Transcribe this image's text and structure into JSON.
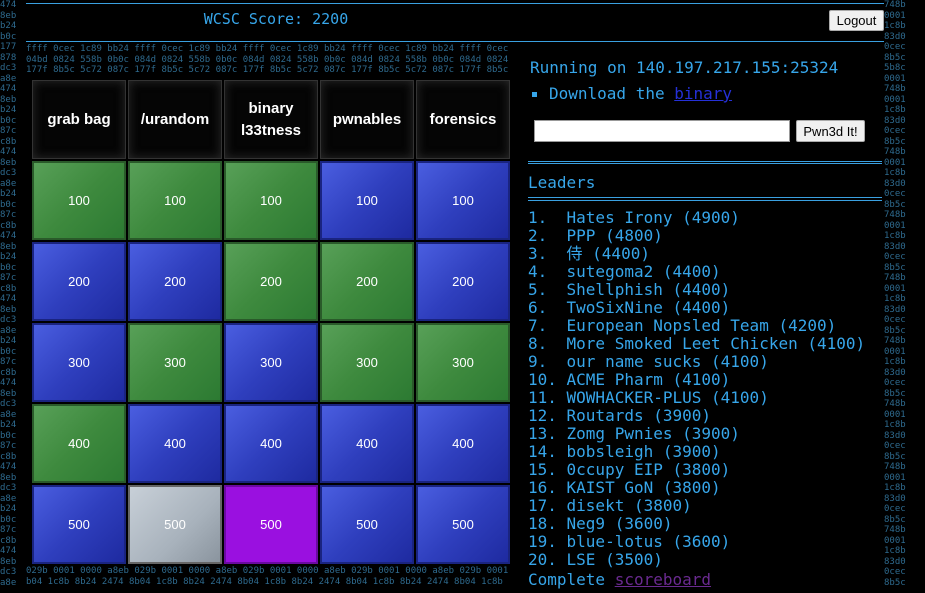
{
  "header": {
    "score_label": "WCSC Score: 2200",
    "logout_label": "Logout"
  },
  "board": {
    "categories": [
      "grab bag",
      "/urandom",
      "binary l33tness",
      "pwnables",
      "forensics"
    ],
    "points": [
      "100",
      "200",
      "300",
      "400",
      "500"
    ],
    "cell_states": [
      [
        "green",
        "blue",
        "blue",
        "green",
        "blue"
      ],
      [
        "green",
        "blue",
        "green",
        "blue",
        "gray"
      ],
      [
        "green",
        "green",
        "blue",
        "blue",
        "purple"
      ],
      [
        "blue",
        "green",
        "green",
        "blue",
        "blue"
      ],
      [
        "blue",
        "blue",
        "green",
        "blue",
        "blue"
      ]
    ],
    "colors": {
      "green": "#3e8a3e",
      "blue": "#2f3fbe",
      "gray": "#a8b2bc",
      "purple": "#9a10e0"
    }
  },
  "sidebar": {
    "running_text": "Running on 140.197.217.155:25324",
    "download_prefix": "Download the",
    "download_link": "binary",
    "flag_input_value": "",
    "submit_label": "Pwn3d It!",
    "leaders_title": "Leaders",
    "leaders": [
      "1.  Hates Irony (4900)",
      "2.  PPP (4800)",
      "3.  侍 (4400)",
      "4.  sutegoma2 (4400)",
      "5.  Shellphish (4400)",
      "6.  TwoSixNine (4400)",
      "7.  European Nopsled Team (4200)",
      "8.  More Smoked Leet Chicken (4100)",
      "9.  our name sucks (4100)",
      "10. ACME Pharm (4100)",
      "11. WOWHACKER-PLUS (4100)",
      "12. Routards (3900)",
      "13. Zomg Pwnies (3900)",
      "14. bobsleigh (3900)",
      "15. 0ccupy EIP (3800)",
      "16. KAIST GoN (3800)",
      "17. disekt (3800)",
      "18. Neg9 (3600)",
      "19. blue-lotus (3600)",
      "20. LSE (3500)"
    ],
    "complete_prefix": "Complete",
    "complete_link": "scoreboard"
  },
  "background": {
    "left_column": [
      "474",
      "8eb",
      "b24",
      "b0c",
      "177",
      "878",
      "dc3",
      "a8e",
      "474",
      "8eb",
      "b24",
      "b0c",
      "87c",
      "c8b",
      "474",
      "8eb",
      "dc3",
      "a8e",
      "b24",
      "b0c",
      "87c",
      "c8b",
      "474",
      "8eb",
      "b24",
      "b0c",
      "87c",
      "c8b",
      "474",
      "8eb",
      "dc3",
      "a8e",
      "b24",
      "b0c",
      "87c",
      "c8b",
      "474",
      "8eb",
      "dc3",
      "a8e",
      "b24",
      "b0c",
      "87c",
      "c8b",
      "474",
      "8eb",
      "dc3",
      "a8e",
      "b24",
      "b0c",
      "87c",
      "c8b",
      "474",
      "8eb",
      "dc3",
      "a8e"
    ],
    "right_column": [
      "748b",
      "0001",
      "1c8b",
      "83d0",
      "0cec",
      "8b5c",
      "5b8c",
      "0001",
      "748b",
      "0001",
      "1c8b",
      "83d0",
      "0cec",
      "8b5c",
      "748b",
      "0001",
      "1c8b",
      "83d0",
      "0cec",
      "8b5c",
      "748b",
      "0001",
      "1c8b",
      "83d0",
      "0cec",
      "8b5c",
      "748b",
      "0001",
      "1c8b",
      "83d0",
      "0cec",
      "8b5c",
      "748b",
      "0001",
      "1c8b",
      "83d0",
      "0cec",
      "8b5c",
      "748b",
      "0001",
      "1c8b",
      "83d0",
      "0cec",
      "8b5c",
      "748b",
      "0001",
      "1c8b",
      "83d0",
      "0cec",
      "8b5c",
      "748b",
      "0001",
      "1c8b",
      "83d0",
      "0cec",
      "8b5c"
    ],
    "band_top": [
      "ffff 0cec 1c89 bb24 ffff 0cec 1c89 bb24 ffff 0cec 1c89 bb24 ffff 0cec 1c89 bb24 ffff 0cec",
      "04bd 0824 558b 0b0c 084d 0824 558b 0b0c 084d 0824 558b 0b0c 084d 0824 558b 0b0c 084d 0824",
      "177f 8b5c 5c72 087c 177f 8b5c 5c72 087c 177f 8b5c 5c72 087c 177f 8b5c 5c72 087c 177f 8b5c"
    ],
    "band_bottom": [
      "029b 0001 0000 a8eb 029b 0001 0000 a8eb 029b 0001 0000 a8eb 029b 0001 0000 a8eb 029b 0001",
      "b04 1c8b 8b24 2474 8b04 1c8b 8b24 2474 8b04 1c8b 8b24 2474 8b04 1c8b 8b24 2474 8b04 1c8b"
    ]
  }
}
